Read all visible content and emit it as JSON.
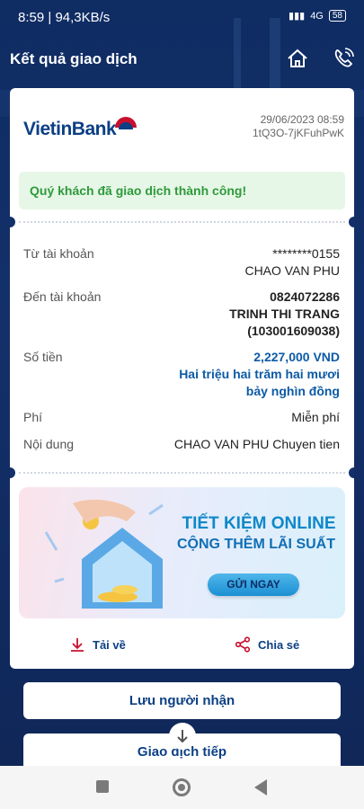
{
  "status_bar": {
    "time": "8:59",
    "speed": "94,3KB/s",
    "battery": "58",
    "network": "4G"
  },
  "header": {
    "title": "Kết quả giao dịch"
  },
  "receipt": {
    "bank_name": "VietinBank",
    "datetime": "29/06/2023 08:59",
    "ref": "1tQ3O-7jKFuhPwK",
    "success_message": "Quý khách đã giao dịch thành công!",
    "rows": {
      "from_label": "Từ tài khoản",
      "from_account": "********0155",
      "from_name": "CHAO VAN PHU",
      "to_label": "Đến tài khoản",
      "to_account": "0824072286",
      "to_name": "TRINH THI TRANG",
      "to_extra": "(103001609038)",
      "amount_label": "Số tiền",
      "amount": "2,227,000 VND",
      "amount_words_1": "Hai triệu hai trăm hai mươi",
      "amount_words_2": "bảy nghìn đồng",
      "fee_label": "Phí",
      "fee": "Miễn phí",
      "content_label": "Nội dung",
      "content": "CHAO VAN PHU Chuyen tien"
    },
    "banner": {
      "title": "TIẾT KIỆM ONLINE",
      "subtitle": "CỘNG THÊM LÃI SUẤT",
      "button": "GỬI NGAY"
    },
    "actions": {
      "download": "Tải về",
      "share": "Chia sẻ"
    }
  },
  "buttons": {
    "save_recipient": "Lưu người nhận",
    "continue": "Giao dịch tiếp"
  },
  "colors": {
    "primary": "#0c3f84",
    "success": "#2e9a3b",
    "background": "#13306a"
  }
}
